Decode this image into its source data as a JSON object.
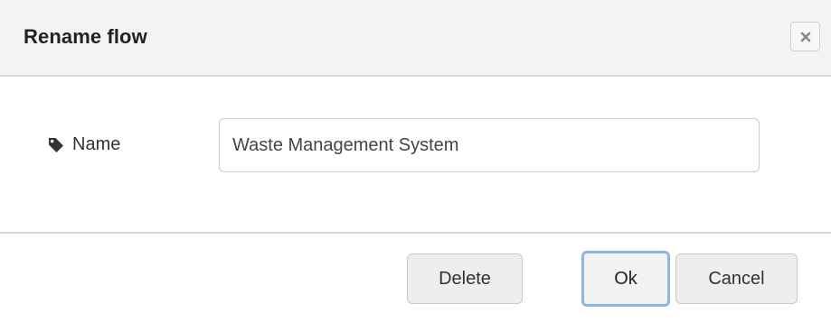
{
  "dialog": {
    "title": "Rename flow",
    "close_icon": "close-icon"
  },
  "form": {
    "name_label": "Name",
    "name_icon": "tag-icon",
    "name_value": "Waste Management System"
  },
  "footer": {
    "delete_label": "Delete",
    "ok_label": "Ok",
    "cancel_label": "Cancel"
  },
  "colors": {
    "titlebar_bg": "#f3f3f3",
    "button_bg": "#eeeeee",
    "focus_ring": "#8fb4e6"
  }
}
